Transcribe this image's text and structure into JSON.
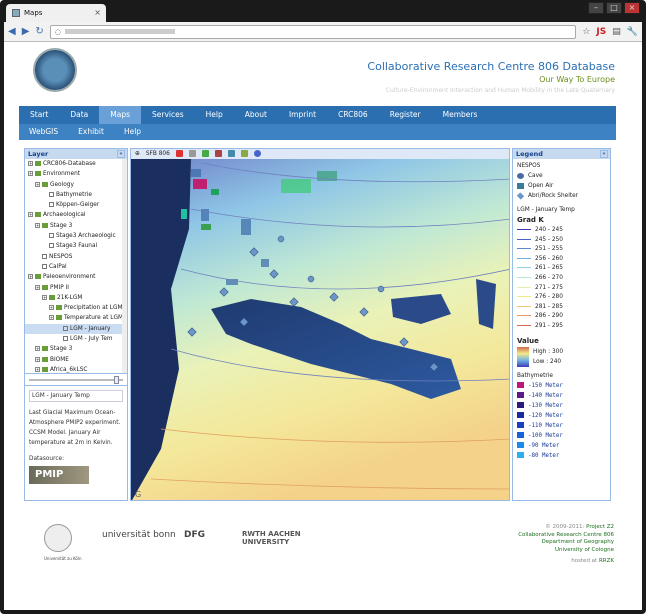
{
  "browser": {
    "tab_title": "Maps",
    "js_badge": "JS"
  },
  "header": {
    "title": "Collaborative Research Centre 806 Database",
    "subtitle": "Our Way To Europe",
    "tagline": "Culture-Environment Interaction and Human Mobility in the Late Quaternary"
  },
  "menu": {
    "items": [
      "Start",
      "Data",
      "Maps",
      "Services",
      "Help",
      "About",
      "Imprint",
      "CRC806",
      "Register",
      "Members"
    ],
    "active": "Maps"
  },
  "submenu": {
    "items": [
      "WebGIS",
      "Exhibit",
      "Help"
    ]
  },
  "layer_panel": {
    "title": "Layer",
    "tree": [
      {
        "label": "CRC806-Database",
        "depth": 0,
        "type": "folder"
      },
      {
        "label": "Environment",
        "depth": 0,
        "type": "folder"
      },
      {
        "label": "Geology",
        "depth": 1,
        "type": "folder"
      },
      {
        "label": "Bathymetrie",
        "depth": 2,
        "type": "check"
      },
      {
        "label": "Köppen-Geiger",
        "depth": 2,
        "type": "check"
      },
      {
        "label": "Archaeological",
        "depth": 0,
        "type": "folder"
      },
      {
        "label": "Stage 3",
        "depth": 1,
        "type": "folder"
      },
      {
        "label": "Stage3 Archaeologic",
        "depth": 2,
        "type": "check"
      },
      {
        "label": "Stage3 Faunal",
        "depth": 2,
        "type": "check"
      },
      {
        "label": "NESPOS",
        "depth": 1,
        "type": "check"
      },
      {
        "label": "CalPal",
        "depth": 1,
        "type": "check"
      },
      {
        "label": "Paleoenvironment",
        "depth": 0,
        "type": "folder"
      },
      {
        "label": "PMIP II",
        "depth": 1,
        "type": "folder"
      },
      {
        "label": "21K-LGM",
        "depth": 2,
        "type": "folder"
      },
      {
        "label": "Precipitation at LGM",
        "depth": 3,
        "type": "folder"
      },
      {
        "label": "Temperature at LGM",
        "depth": 3,
        "type": "folder"
      },
      {
        "label": "LGM - January",
        "depth": 4,
        "type": "check",
        "selected": true
      },
      {
        "label": "LGM - July Tem",
        "depth": 4,
        "type": "check"
      },
      {
        "label": "Stage 3",
        "depth": 1,
        "type": "folder"
      },
      {
        "label": "BIOME",
        "depth": 1,
        "type": "folder"
      },
      {
        "label": "Africa_6kLSC",
        "depth": 1,
        "type": "folder"
      }
    ],
    "info_title": "LGM - January Temp",
    "info_text": "Last Glacial Maximum Ocean-Atmosphere PMIP2 experiment. CCSM Model. January Air temperature at 2m in Kelvin.",
    "datasource_label": "Datasource:",
    "datasource_logo": "PMIP"
  },
  "map": {
    "toolbar_label": "SFB 806",
    "watermark": "G"
  },
  "legend": {
    "title": "Legend",
    "nespos_title": "NESPOS",
    "nespos_items": [
      "Cave",
      "Open Air",
      "Abri/Rock Shelter"
    ],
    "temp_title": "LGM - January Temp",
    "unit": "Grad K",
    "ranges": [
      {
        "label": "240 - 245",
        "color": "#3b3bb8"
      },
      {
        "label": "245 - 250",
        "color": "#4a62c8"
      },
      {
        "label": "251 - 255",
        "color": "#5b8ad6"
      },
      {
        "label": "256 - 260",
        "color": "#6fb2e2"
      },
      {
        "label": "261 - 265",
        "color": "#8fd2e6"
      },
      {
        "label": "266 - 270",
        "color": "#b6e6d2"
      },
      {
        "label": "271 - 275",
        "color": "#dff0b0"
      },
      {
        "label": "276 - 280",
        "color": "#f2ea8a"
      },
      {
        "label": "281 - 285",
        "color": "#f2c878"
      },
      {
        "label": "286 - 290",
        "color": "#e89a64"
      },
      {
        "label": "291 - 295",
        "color": "#d46a50"
      }
    ],
    "value_title": "Value",
    "value_high": "High : 300",
    "value_low": "Low : 240",
    "bathy_title": "Bathymetrie",
    "bathy": [
      {
        "label": "-150 Meter",
        "color": "#c0167a"
      },
      {
        "label": "-140 Meter",
        "color": "#5a1a8a"
      },
      {
        "label": "-130 Meter",
        "color": "#2a1a80"
      },
      {
        "label": "-120 Meter",
        "color": "#1a2aa0"
      },
      {
        "label": "-110 Meter",
        "color": "#1a40c0"
      },
      {
        "label": "-100 Meter",
        "color": "#1a60d8"
      },
      {
        "label": "-90 Meter",
        "color": "#1a8ae8"
      },
      {
        "label": "-80 Meter",
        "color": "#2ab0f0"
      }
    ]
  },
  "footer": {
    "logo1": "Universität zu Köln",
    "logo2": "universität bonn",
    "logo3": "DFG",
    "logo4": "RWTH AACHEN UNIVERSITY",
    "copyright": "© 2009-2011:",
    "project": "Project Z2",
    "org": "Collaborative Research Centre 806",
    "dept": "Department of Geography",
    "uni": "University of Cologne",
    "hosted_label": "hosted at",
    "host": "RRZK"
  }
}
